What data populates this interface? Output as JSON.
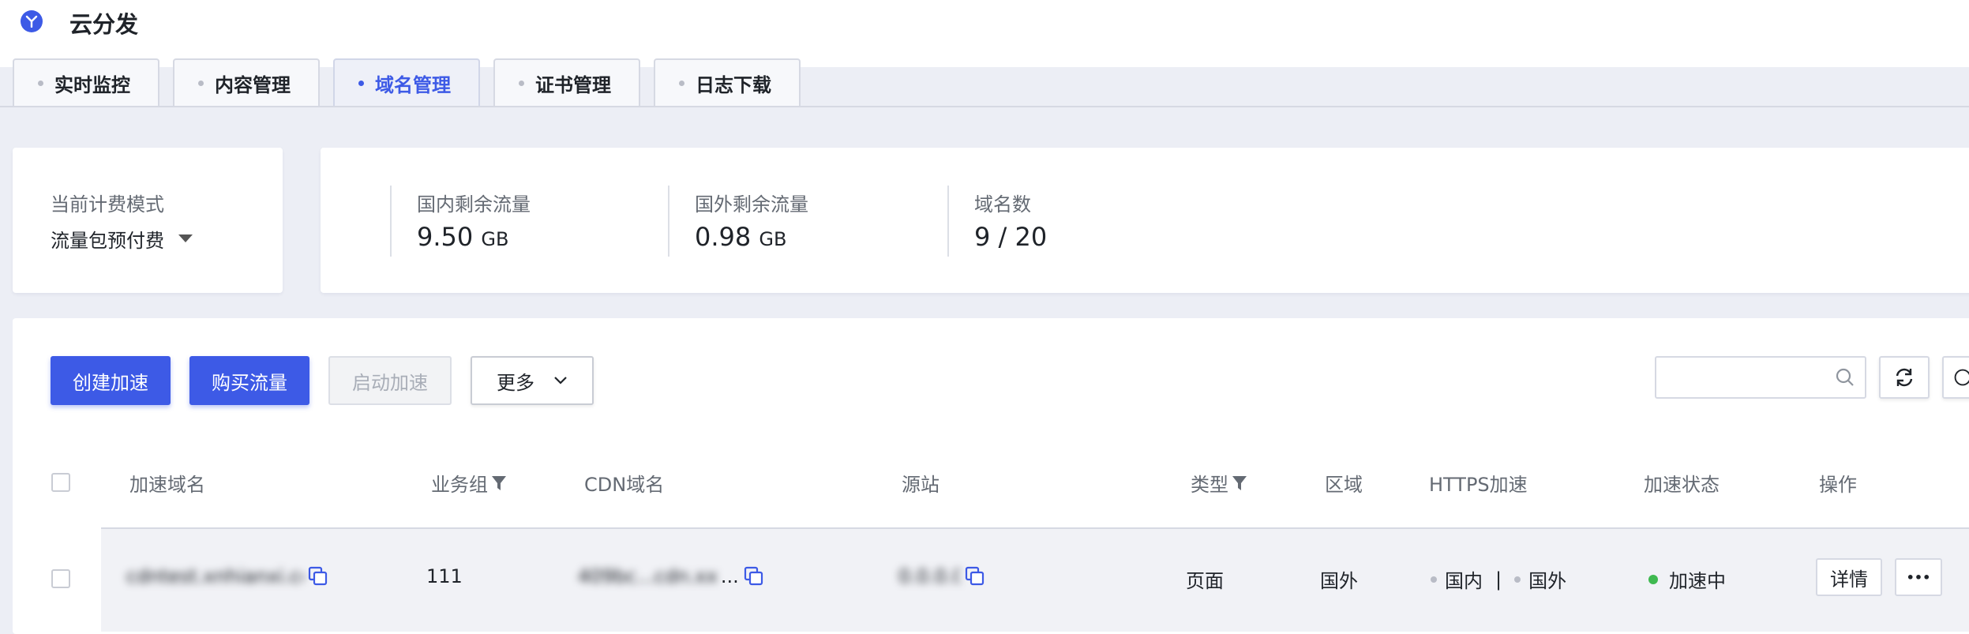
{
  "app": {
    "title": "云分发",
    "accent_color": "#3d5ae6"
  },
  "tabs": [
    {
      "label": "实时监控",
      "active": false
    },
    {
      "label": "内容管理",
      "active": false
    },
    {
      "label": "域名管理",
      "active": true
    },
    {
      "label": "证书管理",
      "active": false
    },
    {
      "label": "日志下载",
      "active": false
    }
  ],
  "billing": {
    "label": "当前计费模式",
    "value": "流量包预付费"
  },
  "stats": [
    {
      "label": "国内剩余流量",
      "value": "9.50",
      "unit": "GB"
    },
    {
      "label": "国外剩余流量",
      "value": "0.98",
      "unit": "GB"
    },
    {
      "label": "域名数",
      "value": "9 / 20",
      "unit": ""
    }
  ],
  "toolbar": {
    "create": "创建加速",
    "buy": "购买流量",
    "start": "启动加速",
    "more": "更多",
    "search_placeholder": ""
  },
  "table": {
    "headers": [
      "加速域名",
      "业务组",
      "CDN域名",
      "源站",
      "类型",
      "区域",
      "HTTPS加速",
      "加速状态",
      "操作"
    ],
    "rows": [
      {
        "domain": "cdntest.xnhianxi.com",
        "group": "111",
        "cdn_domain": "409bc...cdn.xx",
        "origin": "0.0.0.0",
        "type": "页面",
        "region": "国外",
        "https_domestic": "国内",
        "https_separator": "|",
        "https_foreign": "国外",
        "status": "加速中",
        "detail": "详情",
        "more": "•••"
      }
    ]
  },
  "status_color": "#3fb950"
}
